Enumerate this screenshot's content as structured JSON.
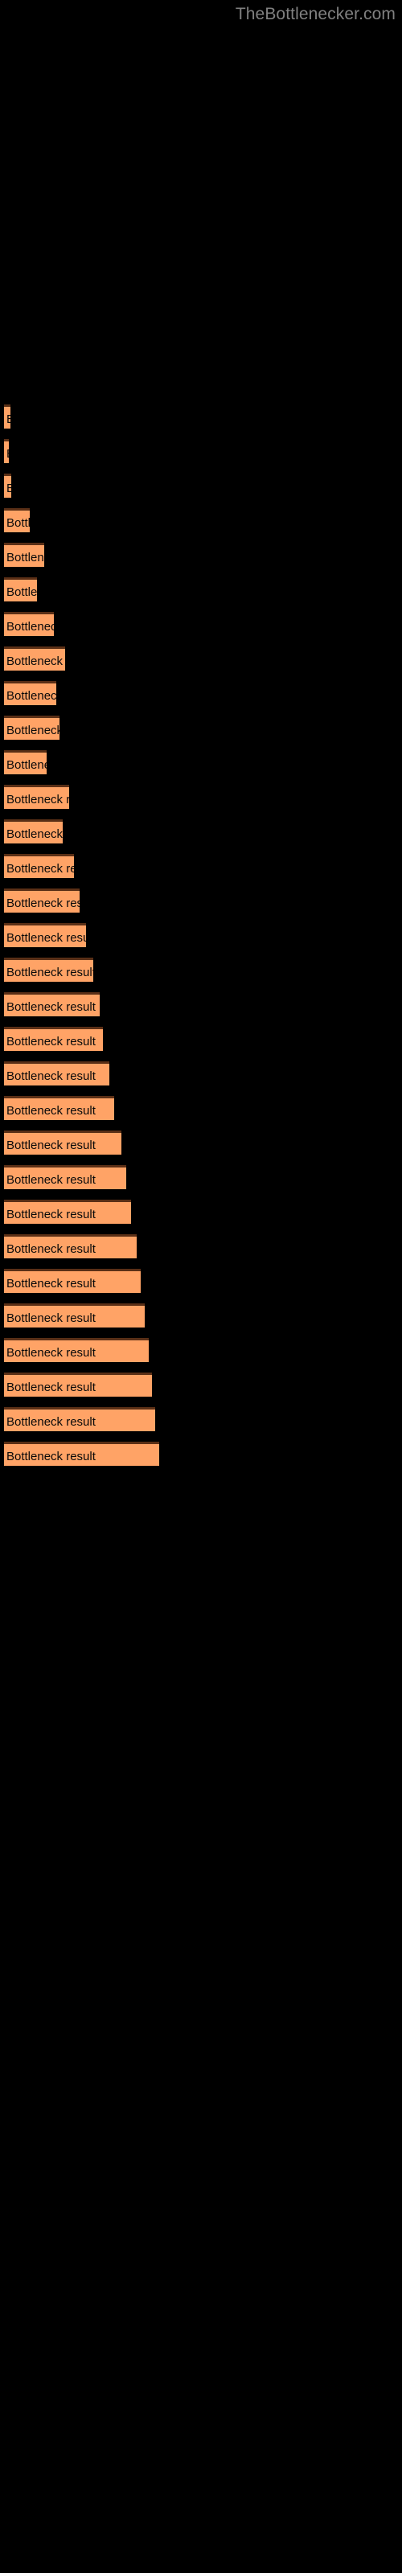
{
  "header": {
    "site_title": "TheBottlenecker.com"
  },
  "colors": {
    "background": "#000000",
    "bar_fill": "#FFA366",
    "bar_border_top": "#5a2f16",
    "bar_label_text": "#0a0a0a",
    "header_text": "#808080"
  },
  "chart_data": {
    "type": "bar",
    "orientation": "horizontal",
    "title": "",
    "subtitle": "",
    "xlabel": "",
    "ylabel": "",
    "grid": false,
    "legend": null,
    "bar_label_text": "Bottleneck result",
    "note": "Horizontal bars on black background; every bar is labelled 'Bottleneck result' with the text clipped to the bar width. Values are bar pixel widths read off the screenshot.",
    "xlim": [
      0,
      200
    ],
    "categories": [
      "bar-1",
      "bar-2",
      "bar-3",
      "bar-4",
      "bar-5",
      "bar-6",
      "bar-7",
      "bar-8",
      "bar-9",
      "bar-10",
      "bar-11",
      "bar-12",
      "bar-13",
      "bar-14",
      "bar-15",
      "bar-16",
      "bar-17",
      "bar-18",
      "bar-19",
      "bar-20",
      "bar-21",
      "bar-22",
      "bar-23",
      "bar-24",
      "bar-25",
      "bar-26",
      "bar-27",
      "bar-28",
      "bar-29",
      "bar-30",
      "bar-31"
    ],
    "values": [
      8,
      6,
      9,
      32,
      50,
      41,
      62,
      76,
      65,
      69,
      53,
      81,
      73,
      87,
      94,
      102,
      111,
      119,
      123,
      131,
      137,
      146,
      152,
      158,
      165,
      170,
      175,
      180,
      184,
      188,
      193
    ],
    "bars": [
      {
        "label": "Bottleneck result",
        "width": 8,
        "y": 503
      },
      {
        "label": "Bottleneck result",
        "width": 6,
        "y": 546
      },
      {
        "label": "Bottleneck result",
        "width": 9,
        "y": 589
      },
      {
        "label": "Bottleneck result",
        "width": 32,
        "y": 632
      },
      {
        "label": "Bottleneck result",
        "width": 50,
        "y": 675
      },
      {
        "label": "Bottleneck result",
        "width": 41,
        "y": 718
      },
      {
        "label": "Bottleneck result",
        "width": 62,
        "y": 761
      },
      {
        "label": "Bottleneck result",
        "width": 76,
        "y": 804
      },
      {
        "label": "Bottleneck result",
        "width": 65,
        "y": 847
      },
      {
        "label": "Bottleneck result",
        "width": 69,
        "y": 890
      },
      {
        "label": "Bottleneck result",
        "width": 53,
        "y": 933
      },
      {
        "label": "Bottleneck result",
        "width": 81,
        "y": 976
      },
      {
        "label": "Bottleneck result",
        "width": 73,
        "y": 1019
      },
      {
        "label": "Bottleneck result",
        "width": 87,
        "y": 1062
      },
      {
        "label": "Bottleneck result",
        "width": 94,
        "y": 1105
      },
      {
        "label": "Bottleneck result",
        "width": 102,
        "y": 1148
      },
      {
        "label": "Bottleneck result",
        "width": 111,
        "y": 1191
      },
      {
        "label": "Bottleneck result",
        "width": 119,
        "y": 1234
      },
      {
        "label": "Bottleneck result",
        "width": 123,
        "y": 1277
      },
      {
        "label": "Bottleneck result",
        "width": 131,
        "y": 1320
      },
      {
        "label": "Bottleneck result",
        "width": 137,
        "y": 1363
      },
      {
        "label": "Bottleneck result",
        "width": 146,
        "y": 1406
      },
      {
        "label": "Bottleneck result",
        "width": 152,
        "y": 1449
      },
      {
        "label": "Bottleneck result",
        "width": 158,
        "y": 1492
      },
      {
        "label": "Bottleneck result",
        "width": 165,
        "y": 1535
      },
      {
        "label": "Bottleneck result",
        "width": 170,
        "y": 1578
      },
      {
        "label": "Bottleneck result",
        "width": 175,
        "y": 1621
      },
      {
        "label": "Bottleneck result",
        "width": 180,
        "y": 1664
      },
      {
        "label": "Bottleneck result",
        "width": 184,
        "y": 1707
      },
      {
        "label": "Bottleneck result",
        "width": 188,
        "y": 1750
      },
      {
        "label": "Bottleneck result",
        "width": 193,
        "y": 1793
      }
    ]
  }
}
